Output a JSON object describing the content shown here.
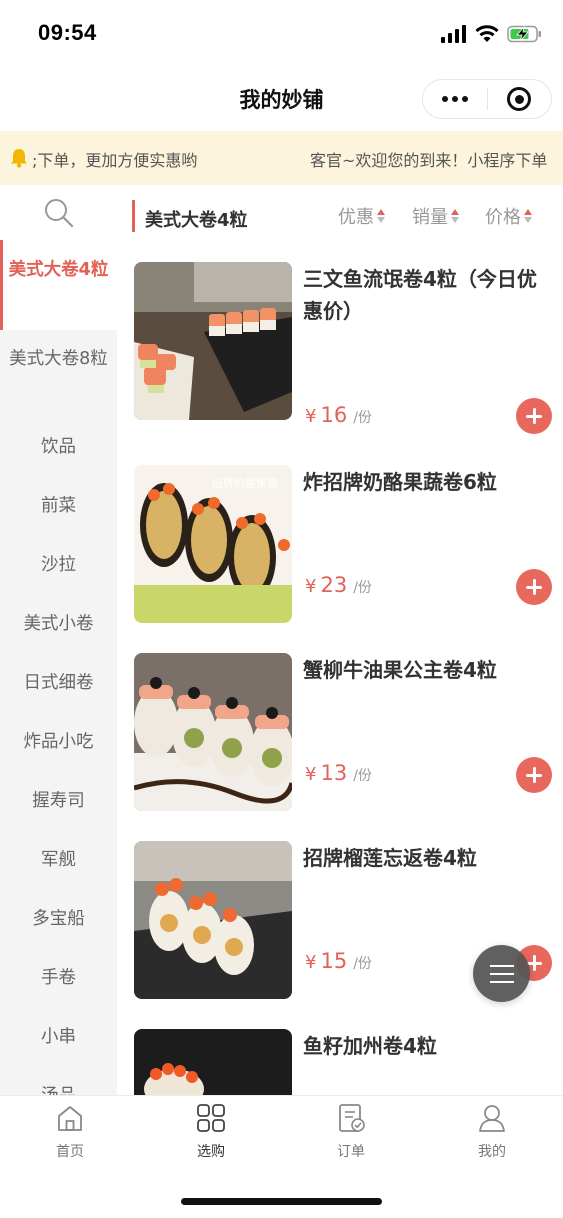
{
  "status_bar": {
    "time": "09:54"
  },
  "nav": {
    "title": "我的妙铺"
  },
  "notice": {
    "segment_a": ";下单，更加方便实惠哟",
    "segment_b": "客官~欢迎您的到来！小程序下单"
  },
  "sidebar": {
    "items": [
      {
        "label": "美式大卷4粒",
        "active": true
      },
      {
        "label": "美式大卷8粒",
        "active": false
      },
      {
        "label": "饮品",
        "active": false
      },
      {
        "label": "前菜",
        "active": false
      },
      {
        "label": "沙拉",
        "active": false
      },
      {
        "label": "美式小卷",
        "active": false
      },
      {
        "label": "日式细卷",
        "active": false
      },
      {
        "label": "炸品小吃",
        "active": false
      },
      {
        "label": "握寿司",
        "active": false
      },
      {
        "label": "军舰",
        "active": false
      },
      {
        "label": "多宝船",
        "active": false
      },
      {
        "label": "手卷",
        "active": false
      },
      {
        "label": "小串",
        "active": false
      },
      {
        "label": "汤品",
        "active": false
      }
    ]
  },
  "category": {
    "title": "美式大卷4粒"
  },
  "sort": {
    "discount": "优惠",
    "sales": "销量",
    "price": "价格"
  },
  "products": [
    {
      "name": "三文鱼流氓卷4粒（今日优惠价）",
      "currency": "¥",
      "price": "16",
      "unit": "/份"
    },
    {
      "name": "炸招牌奶酪果蔬卷6粒",
      "currency": "¥",
      "price": "23",
      "unit": "/份",
      "image_caption": "招牌奶酪果蔬"
    },
    {
      "name": "蟹柳牛油果公主卷4粒",
      "currency": "¥",
      "price": "13",
      "unit": "/份"
    },
    {
      "name": "招牌榴莲忘返卷4粒",
      "currency": "¥",
      "price": "15",
      "unit": "/份"
    },
    {
      "name": "鱼籽加州卷4粒",
      "currency": "¥",
      "price": "",
      "unit": ""
    }
  ],
  "tabbar": {
    "home": "首页",
    "shop": "选购",
    "orders": "订单",
    "mine": "我的"
  },
  "colors": {
    "accent": "#e2625a",
    "notice_bg": "#fdf4dd",
    "sidebar_bg": "#f4f4f4"
  }
}
